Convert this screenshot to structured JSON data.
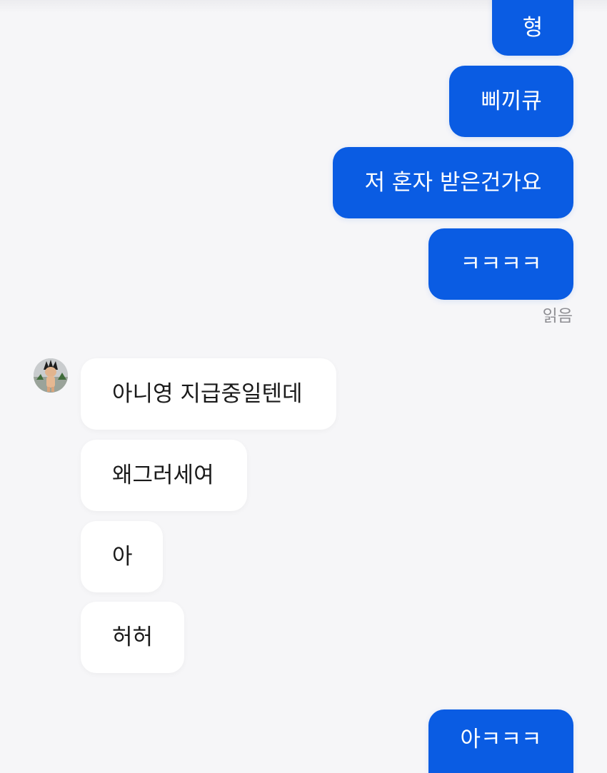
{
  "messages": {
    "outgoing_1": "형",
    "outgoing_2": "삐끼큐",
    "outgoing_3": "저 혼자 받은건가요",
    "outgoing_4": "ㅋㅋㅋㅋ",
    "read_status": "읽음",
    "incoming_1": "아니영 지급중일텐데",
    "incoming_2": "왜그러세여",
    "incoming_3": "아",
    "incoming_4": "허허",
    "outgoing_5": "아ㅋㅋㅋ"
  },
  "colors": {
    "outgoing_bubble": "#0a5ce3",
    "incoming_bubble": "#ffffff",
    "background": "#f6f6f8"
  },
  "icons": {
    "avatar": "character-avatar"
  }
}
